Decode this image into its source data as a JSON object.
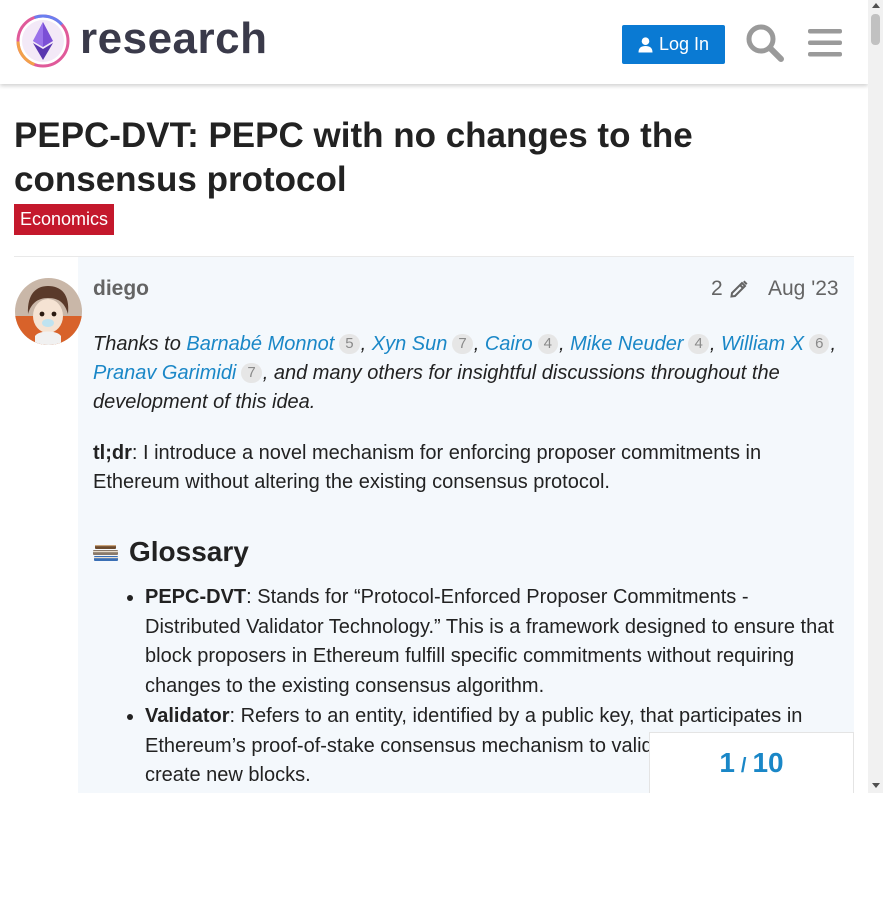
{
  "header": {
    "logo_text": "research",
    "login_label": "Log In",
    "search_icon": "search-icon",
    "menu_icon": "hamburger-menu-icon"
  },
  "topic": {
    "title": "PEPC-DVT: PEPC with no changes to the consensus protocol",
    "category": "Economics",
    "category_color": "#c4182c"
  },
  "post": {
    "username": "diego",
    "edit_count": "2",
    "date": "Aug '23",
    "thanks_prefix": "Thanks to ",
    "mentions": [
      {
        "name": "Barnabé Monnot",
        "count": "5"
      },
      {
        "name": "Xyn Sun",
        "count": "7"
      },
      {
        "name": "Cairo",
        "count": "4"
      },
      {
        "name": "Mike Neuder",
        "count": "4"
      },
      {
        "name": "William X",
        "count": "6"
      },
      {
        "name": "Pranav Garimidi",
        "count": "7"
      }
    ],
    "thanks_suffix": ", and many others for insightful discussions throughout the development of this idea.",
    "tldr_label": "tl;dr",
    "tldr_text": ": I introduce a novel mechanism for enforcing proposer commitments in Ethereum without altering the existing consensus protocol.",
    "glossary_heading": "Glossary",
    "glossary": [
      {
        "term": "PEPC-DVT",
        "text": ": Stands for “Protocol-Enforced Proposer Commitments - Distributed Validator Technology.” This is a framework designed to ensure that block proposers in Ethereum fulfill specific commitments without requiring changes to the existing consensus algorithm."
      },
      {
        "term": "Validator",
        "text": ": Refers to an entity, identified by a public key, that participates in Ethereum’s proof-of-stake consensus mechanism to validate transactions and create new blocks."
      }
    ]
  },
  "timeline": {
    "current": "1",
    "separator": "/",
    "total": "10"
  },
  "colors": {
    "accent": "#0a7ad3",
    "link": "#1a87c7",
    "post_bg": "#f4f8fc"
  }
}
